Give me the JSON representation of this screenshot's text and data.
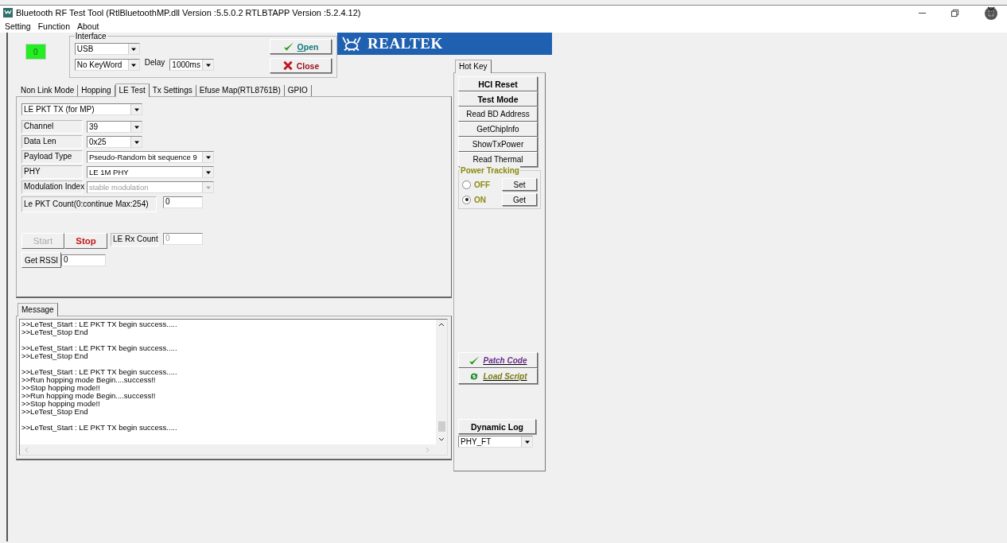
{
  "window": {
    "title": "Bluetooth RF Test Tool (RtlBluetoothMP.dll Version :5.5.0.2   RTLBTAPP Version :5.2.4.12)"
  },
  "menu": [
    "Setting",
    "Function",
    "About"
  ],
  "status_indicator": {
    "text": "0"
  },
  "interface": {
    "title": "Interface",
    "port": "USB",
    "keyword": "No KeyWord",
    "delay_label": "Delay",
    "delay": "1000ms"
  },
  "connection_buttons": [
    {
      "kind": "open",
      "label": "Open"
    },
    {
      "kind": "close",
      "label": "Close"
    }
  ],
  "logo": {
    "text": "REALTEK"
  },
  "tabs": [
    {
      "label": "Non Link Mode",
      "selected": false
    },
    {
      "label": "Hopping",
      "selected": false
    },
    {
      "label": "LE Test",
      "selected": true
    },
    {
      "label": "Tx Settings",
      "selected": false
    },
    {
      "label": "Efuse Map(RTL8761B)",
      "selected": false
    },
    {
      "label": "GPIO",
      "selected": false
    }
  ],
  "le_test": {
    "mode": "LE PKT TX (for MP)",
    "fields": [
      {
        "label": "Channel",
        "value": "39",
        "kind": "short",
        "disabled": false
      },
      {
        "label": "Data Len",
        "value": "0x25",
        "kind": "short",
        "disabled": false
      },
      {
        "label": "Payload Type",
        "value": "Pseudo-Random bit sequence 9",
        "kind": "long",
        "disabled": false
      },
      {
        "label": "PHY",
        "value": "LE 1M PHY",
        "kind": "long",
        "disabled": false
      },
      {
        "label": "Modulation Index",
        "value": "stable modulation",
        "kind": "long",
        "disabled": true
      }
    ],
    "pkt_count_label": "Le PKT Count(0:continue Max:254)",
    "pkt_count": "0",
    "actions": [
      {
        "label": "Start",
        "disabled": true
      },
      {
        "label": "Stop",
        "disabled": false
      }
    ],
    "rx_count_label": "LE Rx Count",
    "rx_count": "0",
    "rssi_button": "Get RSSI",
    "rssi": "0"
  },
  "message": {
    "tab": "Message",
    "blocks": [
      [
        ">>LeTest_Start : LE PKT TX begin success.....",
        ">>LeTest_Stop End"
      ],
      [
        ">>LeTest_Start : LE PKT TX begin success.....",
        ">>LeTest_Stop End"
      ],
      [
        ">>LeTest_Start : LE PKT TX begin success.....",
        ">>Run hopping mode Begin....success!!",
        ">>Stop hopping mode!!",
        ">>Run hopping mode Begin....success!!",
        ">>Stop hopping mode!!",
        ">>LeTest_Stop End"
      ],
      [
        ">>LeTest_Start : LE PKT TX begin success....."
      ]
    ]
  },
  "hot_key": {
    "tab": "Hot Key",
    "buttons": [
      {
        "label": "HCI Reset",
        "kind": "bold"
      },
      {
        "label": "Test Mode",
        "kind": "bold"
      },
      {
        "label": "Read BD Address",
        "kind": "plain"
      },
      {
        "label": "GetChipInfo",
        "kind": "plain"
      },
      {
        "label": "ShowTxPower",
        "kind": "plain"
      },
      {
        "label": "Read Thermal",
        "kind": "plain"
      }
    ],
    "power_tracking": {
      "title": "Power Tracking",
      "options": [
        {
          "label": "OFF",
          "selected": false,
          "button": "Set"
        },
        {
          "label": "ON",
          "selected": true,
          "button": "Get"
        }
      ]
    },
    "patch_code": "Patch Code",
    "load_script": "Load Script",
    "dynamic_log": "Dynamic Log",
    "log_level": "PHY_FT"
  }
}
